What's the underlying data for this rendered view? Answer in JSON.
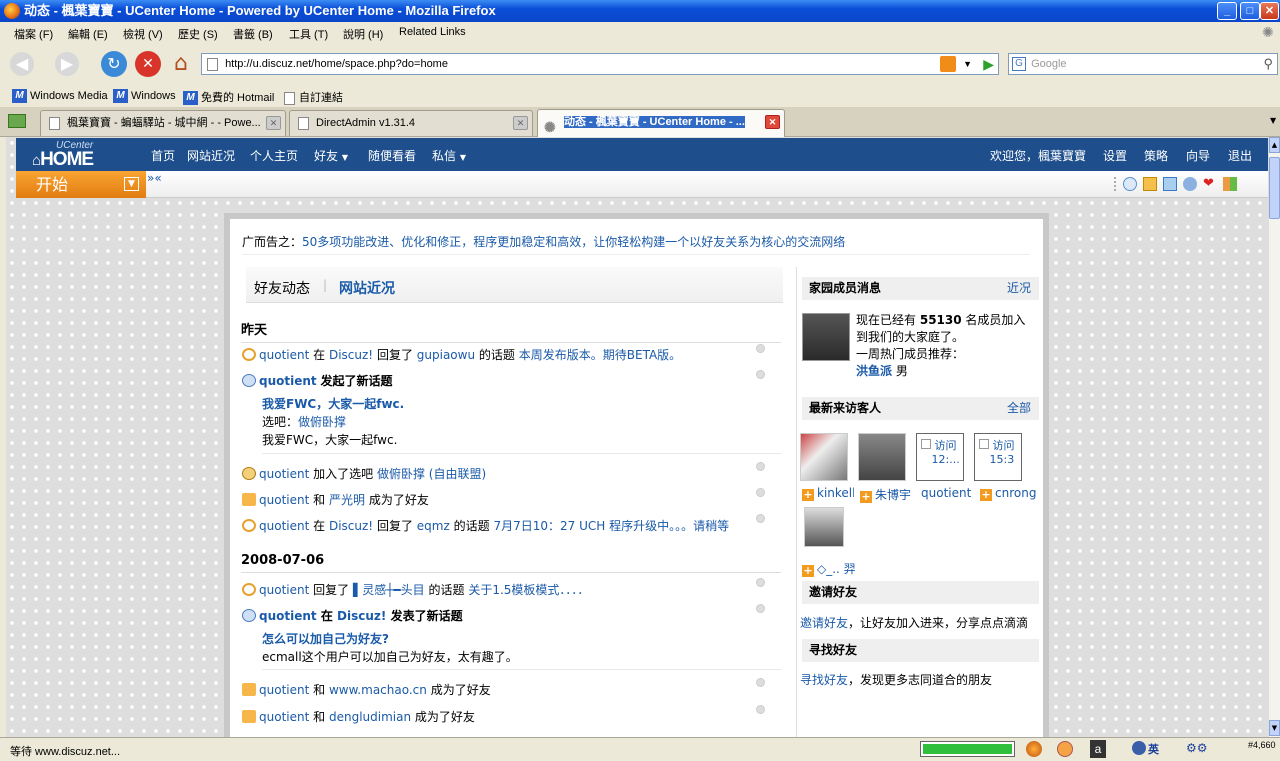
{
  "window": {
    "title": "动态 - 楓葉寶寶 - UCenter Home - Powered by UCenter Home - Mozilla Firefox"
  },
  "menu": [
    "檔案 (F)",
    "編輯 (E)",
    "檢視 (V)",
    "歷史 (S)",
    "書籤 (B)",
    "工具 (T)",
    "說明 (H)",
    "Related Links"
  ],
  "url": "http://u.discuz.net/home/space.php?do=home",
  "search_placeholder": "Google",
  "bookmarks": [
    "Windows Media",
    "Windows",
    "免費的 Hotmail",
    "自訂連結"
  ],
  "tabs": [
    "楓葉寶寶 - 蝙蝠驛站 - 城中網 - - Powe...",
    "DirectAdmin v1.31.4",
    "动态 - 楓葉寶寶 - UCenter Home - ..."
  ],
  "uc": {
    "logo_small": "UCenter",
    "logo_big": "HOME",
    "nav": [
      "首页",
      "网站近况",
      "个人主页",
      "好友",
      "随便看看",
      "私信"
    ],
    "user_nav": [
      "欢迎您，楓葉寶寶",
      "设置",
      "策略",
      "向导",
      "退出"
    ],
    "start": "开始"
  },
  "ad": {
    "prefix": "广而告之：",
    "text": "50多项功能改进、优化和修正，程序更加稳定和高效，让你轻松构建一个以好友关系为核心的交流网络"
  },
  "feed_tabs": {
    "active": "好友动态",
    "other": "网站近况"
  },
  "days": [
    {
      "label": "昨天",
      "items": [
        {
          "user": "quotient",
          "t1": "在",
          "link1": "Discuz!",
          "t2": "回复了",
          "link2": "gupiaowu",
          "t3": "的话题",
          "link3": "本周发布版本。期待BETA版。"
        },
        {
          "user": "quotient",
          "t1": "发起了新话题",
          "sub_title": "我爱FWC，大家一起fwc.",
          "sub_line_label": "选吧：",
          "sub_line_link": "做俯卧撑",
          "sub_body": "我爱FWC，大家一起fwc."
        },
        {
          "user": "quotient",
          "t1": "加入了选吧",
          "link1": "做俯卧撑 (自由联盟)"
        },
        {
          "user": "quotient",
          "t1": "和",
          "link1": "严光明",
          "t2": "成为了好友"
        },
        {
          "user": "quotient",
          "t1": "在",
          "link1": "Discuz!",
          "t2": "回复了",
          "link2": "eqmz",
          "t3": "的话题",
          "link3": "7月7日10：27 UCH 程序升级中。。。请稍等"
        }
      ]
    },
    {
      "label": "2008-07-06",
      "items": [
        {
          "user": "quotient",
          "t1": "回复了",
          "link1": "▌灵感┼━头目",
          "t2": "的话题",
          "link2": "关于1.5模板模式．．．．"
        },
        {
          "user": "quotient",
          "t1": "在",
          "link1": "Discuz!",
          "t2": "发表了新话题",
          "sub_title": "怎么可以加自己为好友?",
          "sub_body": "ecmall这个用户可以加自己为好友，太有趣了。"
        },
        {
          "user": "quotient",
          "t1": "和",
          "link1": "www.machao.cn",
          "t2": "成为了好友"
        },
        {
          "user": "quotient",
          "t1": "和",
          "link1": "dengludimian",
          "t2": "成为了好友"
        }
      ]
    }
  ],
  "sidebar": {
    "members": {
      "title": "家园成员消息",
      "more": "近况",
      "l1a": "现在已经有",
      "count": "55130",
      "l1b": "名成员加入",
      "l2": "到我们的大家庭了。",
      "l3": "一周热门成员推荐：",
      "hot_user": "洪鱼派",
      "gender": "男"
    },
    "visitors": {
      "title": "最新来访客人",
      "more": "全部",
      "names": [
        "kinkelly",
        "朱博宇",
        "quotient",
        "cnrong",
        "◇_.. 羿"
      ],
      "placeholder_text": "访问",
      "times": [
        "12:...",
        "15:3"
      ]
    },
    "invite": {
      "title": "邀请好友",
      "link": "邀请好友",
      "text": "，让好友加入进来，分享点点滴滴"
    },
    "find": {
      "title": "寻找好友",
      "link": "寻找好友",
      "text": "，发现更多志同道合的朋友"
    }
  },
  "status": {
    "text": "等待 www.discuz.net...",
    "tray": "#4,660"
  }
}
